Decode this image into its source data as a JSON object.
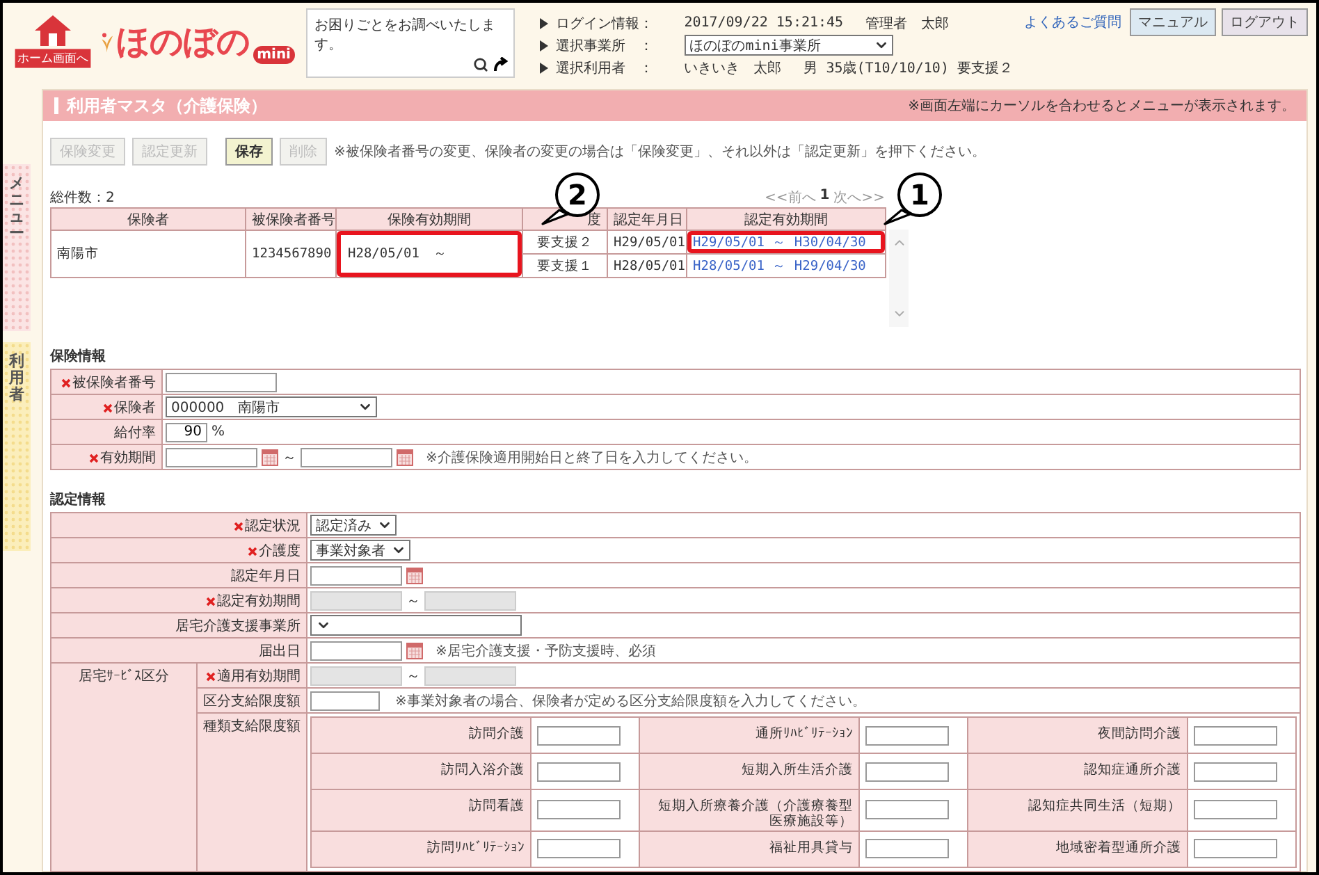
{
  "header": {
    "home_label": "ホーム画面へ",
    "logo": "ほのぼの",
    "logo_badge": "mini",
    "help_text": "お困りごとをお調べいたします。",
    "info": [
      {
        "label": "ログイン情報：",
        "kind": "text",
        "value": "2017/09/22 15:21:45",
        "extra": "管理者　太郎"
      },
      {
        "label": "選択事業所　：",
        "kind": "select",
        "value": "ほのぼのmini事業所"
      },
      {
        "label": "選択利用者　：",
        "kind": "text",
        "value": "いきいき　太郎",
        "extra": "男 35歳(T10/10/10) 要支援２"
      }
    ],
    "faq": "よくあるご質問",
    "buttons": [
      "マニュアル",
      "ログアウト"
    ]
  },
  "side_tabs": [
    {
      "label": "メニュー",
      "kind": "menu"
    },
    {
      "label": "利用者",
      "kind": "user"
    }
  ],
  "title": "利用者マスタ（介護保険）",
  "title_note": "※画面左端にカーソルを合わせるとメニューが表示されます。",
  "actions": [
    {
      "label": "保険変更",
      "disabled": true
    },
    {
      "label": "認定更新",
      "disabled": true
    },
    {
      "label": "保存",
      "disabled": false
    },
    {
      "label": "削除",
      "disabled": true
    }
  ],
  "action_note": "※被保険者番号の変更、保険者の変更の場合は「保険変更」、それ以外は「認定更新」を押下ください。",
  "list": {
    "count": "総件数：2",
    "pager": {
      "prev": "<<前へ",
      "page": "1",
      "next": "次へ>>"
    },
    "columns": [
      "保険者",
      "被保険者番号",
      "保険有効期間",
      "度",
      "認定年月日",
      "認定有効期間"
    ],
    "rows": [
      {
        "insurer": "南陽市",
        "number": "1234567890",
        "period": "H28/05/01　～",
        "highlighted": true,
        "callout": "2",
        "certs": [
          {
            "care": "要支援２",
            "date": "H29/05/01",
            "period": "H29/05/01 ～ H30/04/30",
            "highlighted": true,
            "callout": "1"
          },
          {
            "care": "要支援１",
            "date": "H28/05/01",
            "period": "H28/05/01 ～ H29/04/30",
            "highlighted": false
          }
        ]
      }
    ]
  },
  "insurance": {
    "title": "保険情報",
    "fields": [
      {
        "label": "被保険者番号",
        "required": true,
        "kind": "text"
      },
      {
        "label": "保険者",
        "required": true,
        "kind": "select",
        "value": "000000　南陽市"
      },
      {
        "label": "給付率",
        "required": false,
        "kind": "rate",
        "value": "90",
        "unit": "%"
      },
      {
        "label": "有効期間",
        "required": true,
        "kind": "range",
        "sep": "～",
        "calendar": true,
        "disabled": false,
        "note": "※介護保険適用開始日と終了日を入力してください。"
      }
    ]
  },
  "certification": {
    "title": "認定情報",
    "fields": [
      {
        "label": "認定状況",
        "required": true,
        "kind": "select",
        "value": "認定済み"
      },
      {
        "label": "介護度",
        "required": true,
        "kind": "select",
        "value": "事業対象者"
      },
      {
        "label": "認定年月日",
        "required": false,
        "kind": "date"
      },
      {
        "label": "認定有効期間",
        "required": true,
        "kind": "range",
        "sep": "～",
        "calendar": false,
        "disabled": true
      },
      {
        "label": "居宅介護支援事業所",
        "required": false,
        "kind": "wideselect"
      },
      {
        "label": "届出日",
        "required": false,
        "kind": "date",
        "note": "※居宅介護支援・予防支援時、必須"
      }
    ],
    "group": {
      "label": "居宅ｻｰﾋﾞｽ区分",
      "fields": [
        {
          "label": "適用有効期間",
          "required": true,
          "kind": "range",
          "sep": "～",
          "calendar": false,
          "disabled": true
        },
        {
          "label": "区分支給限度額",
          "required": false,
          "kind": "text",
          "note": "※事業対象者の場合、保険者が定める区分支給限度額を入力してください。"
        }
      ],
      "grid_label": "種類支給限度額",
      "grid": [
        "訪問介護",
        "通所ﾘﾊﾋﾞﾘﾃｰｼｮﾝ",
        "夜間訪問介護",
        "訪問入浴介護",
        "短期入所生活介護",
        "認知症通所介護",
        "訪問看護",
        "短期入所療養介護（介護療養型医療施設等）",
        "認知症共同生活（短期）",
        "訪問ﾘﾊﾋﾞﾘﾃｰｼｮﾝ",
        "福祉用具貸与",
        "地域密着型通所介護"
      ]
    }
  }
}
